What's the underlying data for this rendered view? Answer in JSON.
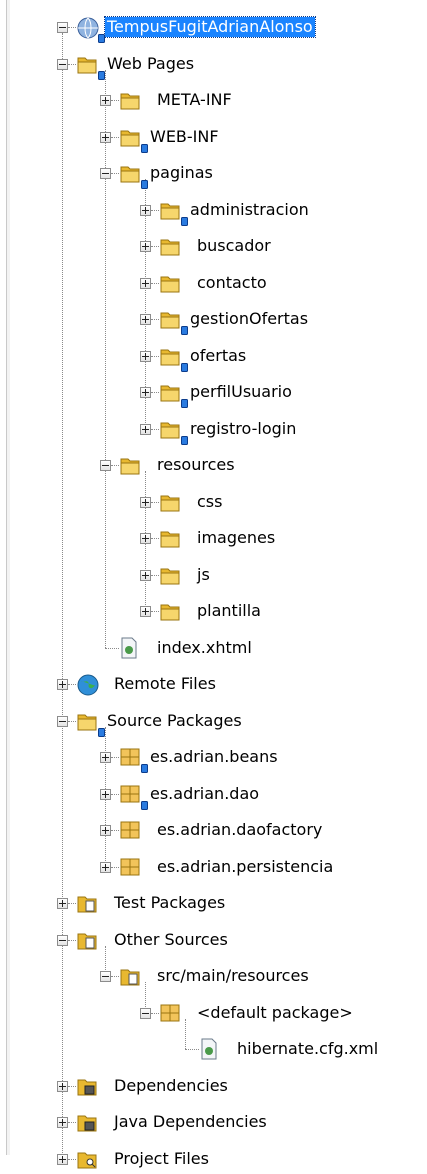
{
  "tree": [
    {
      "label": "TempusFugitAdrianAlonso",
      "icon": "globe-project-icon",
      "badge": true,
      "selected": true,
      "depth": 0,
      "expanded": true
    },
    {
      "label": "Web Pages",
      "icon": "web-pages-folder-icon",
      "badge": true,
      "depth": 1,
      "expanded": true
    },
    {
      "label": "META-INF",
      "icon": "folder-icon",
      "badge": false,
      "depth": 2,
      "expanded": false
    },
    {
      "label": "WEB-INF",
      "icon": "folder-icon",
      "badge": true,
      "depth": 2,
      "expanded": false
    },
    {
      "label": "paginas",
      "icon": "folder-icon",
      "badge": true,
      "depth": 2,
      "expanded": true
    },
    {
      "label": "administracion",
      "icon": "folder-icon",
      "badge": true,
      "depth": 3,
      "expanded": false
    },
    {
      "label": "buscador",
      "icon": "folder-icon",
      "badge": false,
      "depth": 3,
      "expanded": false
    },
    {
      "label": "contacto",
      "icon": "folder-icon",
      "badge": false,
      "depth": 3,
      "expanded": false
    },
    {
      "label": "gestionOfertas",
      "icon": "folder-icon",
      "badge": true,
      "depth": 3,
      "expanded": false
    },
    {
      "label": "ofertas",
      "icon": "folder-icon",
      "badge": true,
      "depth": 3,
      "expanded": false
    },
    {
      "label": "perfilUsuario",
      "icon": "folder-icon",
      "badge": true,
      "depth": 3,
      "expanded": false
    },
    {
      "label": "registro-login",
      "icon": "folder-icon",
      "badge": true,
      "depth": 3,
      "expanded": false
    },
    {
      "label": "resources",
      "icon": "folder-icon",
      "badge": false,
      "depth": 2,
      "expanded": true
    },
    {
      "label": "css",
      "icon": "folder-icon",
      "badge": false,
      "depth": 3,
      "expanded": false
    },
    {
      "label": "imagenes",
      "icon": "folder-icon",
      "badge": false,
      "depth": 3,
      "expanded": false
    },
    {
      "label": "js",
      "icon": "folder-icon",
      "badge": false,
      "depth": 3,
      "expanded": false
    },
    {
      "label": "plantilla",
      "icon": "folder-icon",
      "badge": false,
      "depth": 3,
      "expanded": false
    },
    {
      "label": "index.xhtml",
      "icon": "xhtml-file-icon",
      "badge": false,
      "depth": 2,
      "leaf": true
    },
    {
      "label": "Remote Files",
      "icon": "remote-globe-icon",
      "badge": false,
      "depth": 1,
      "expanded": false
    },
    {
      "label": "Source Packages",
      "icon": "source-packages-icon",
      "badge": true,
      "depth": 1,
      "expanded": true
    },
    {
      "label": "es.adrian.beans",
      "icon": "package-icon",
      "badge": true,
      "depth": 2,
      "expanded": false
    },
    {
      "label": "es.adrian.dao",
      "icon": "package-icon",
      "badge": true,
      "depth": 2,
      "expanded": false
    },
    {
      "label": "es.adrian.daofactory",
      "icon": "package-icon",
      "badge": false,
      "depth": 2,
      "expanded": false
    },
    {
      "label": "es.adrian.persistencia",
      "icon": "package-icon",
      "badge": false,
      "depth": 2,
      "expanded": false
    },
    {
      "label": "Test Packages",
      "icon": "test-packages-icon",
      "badge": false,
      "depth": 1,
      "expanded": false
    },
    {
      "label": "Other Sources",
      "icon": "other-sources-icon",
      "badge": false,
      "depth": 1,
      "expanded": true
    },
    {
      "label": "src/main/resources",
      "icon": "resources-folder-icon",
      "badge": false,
      "depth": 2,
      "expanded": true
    },
    {
      "label": "<default package>",
      "icon": "package-icon",
      "badge": false,
      "depth": 3,
      "expanded": true
    },
    {
      "label": "hibernate.cfg.xml",
      "icon": "xml-file-icon",
      "badge": false,
      "depth": 4,
      "leaf": true
    },
    {
      "label": "Dependencies",
      "icon": "dependencies-icon",
      "badge": false,
      "depth": 1,
      "expanded": false
    },
    {
      "label": "Java Dependencies",
      "icon": "java-dependencies-icon",
      "badge": false,
      "depth": 1,
      "expanded": false
    },
    {
      "label": "Project Files",
      "icon": "project-files-icon",
      "badge": false,
      "depth": 1,
      "expanded": false
    }
  ]
}
